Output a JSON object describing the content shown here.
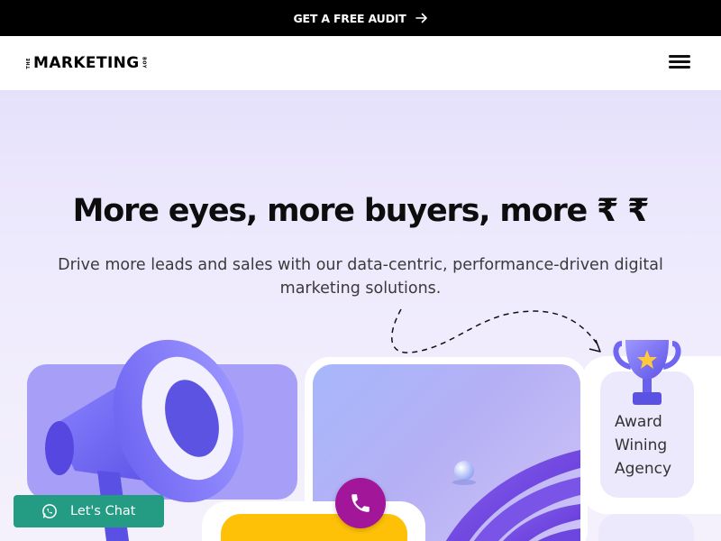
{
  "topbar": {
    "cta_label": "GET A FREE AUDIT"
  },
  "header": {
    "logo": {
      "prefix": "THE",
      "main": "MARKETING",
      "suffix": "BOY"
    }
  },
  "hero": {
    "headline": "More eyes, more buyers, more ₹ ₹",
    "subheadline": "Drive more leads and sales with our data-centric, performance-driven digital marketing solutions."
  },
  "award": {
    "line1": "Award",
    "line2": "Wining",
    "line3": "Agency"
  },
  "chat": {
    "label": "Let's Chat"
  },
  "colors": {
    "topbar": "#000000",
    "hero_bg": "#ece9fc",
    "card_purple": "#a79ff7",
    "call_button": "#a2169a",
    "chat_button": "#249b83",
    "cta_yellow": "#ffc107"
  },
  "icons": {
    "topbar_arrow": "arrow-right-icon",
    "menu": "hamburger-menu-icon",
    "trophy": "trophy-icon",
    "megaphone": "megaphone-icon",
    "call": "phone-icon",
    "chat": "whatsapp-icon"
  }
}
